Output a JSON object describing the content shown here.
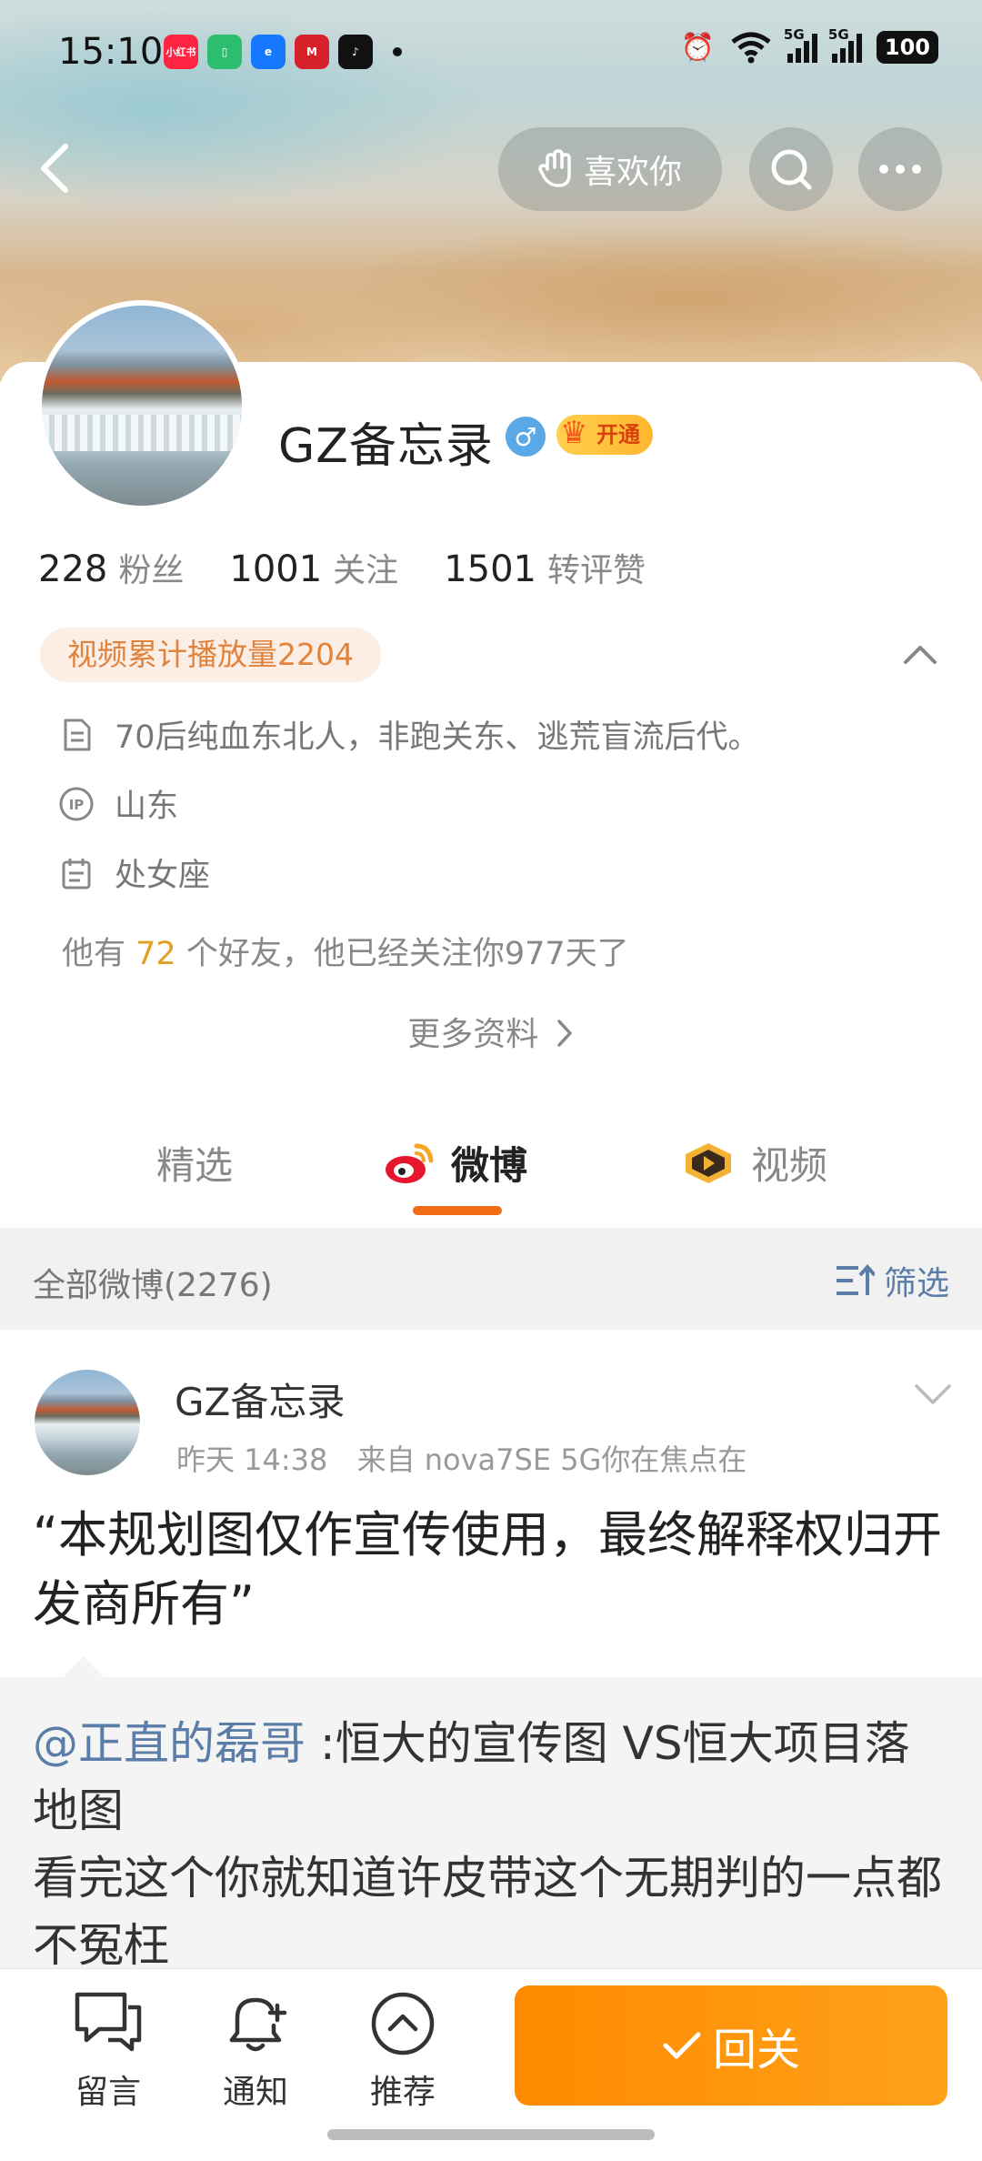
{
  "status_bar": {
    "time": "15:10",
    "app_icons": [
      "小红书",
      "battery-app-icon",
      "edge-icon",
      "cmb-icon",
      "tiktok-icon"
    ],
    "network_1": "5G",
    "network_2": "5G",
    "battery": "100"
  },
  "header": {
    "like_label": "喜欢你"
  },
  "profile": {
    "name": "GZ备忘录",
    "gender_symbol": "♂",
    "vip_label": "开通",
    "stats": [
      {
        "num": "228",
        "label": "粉丝"
      },
      {
        "num": "1001",
        "label": "关注"
      },
      {
        "num": "1501",
        "label": "转评赞"
      }
    ],
    "video_tag": "视频累计播放量2204",
    "bio": "70后纯血东北人，非跑关东、逃荒盲流后代。",
    "ip": "山东",
    "zodiac": "处女座",
    "friends_prefix": "他有",
    "friends_count": "72",
    "friends_suffix": "个好友，他已经关注你977天了",
    "more_info": "更多资料"
  },
  "tabs": [
    {
      "label": "精选"
    },
    {
      "label": "微博"
    },
    {
      "label": "视频"
    }
  ],
  "filter_bar": {
    "all_label": "全部微博(2276)",
    "filter_label": "筛选"
  },
  "post": {
    "author": "GZ备忘录",
    "time": "昨天 14:38",
    "source": "来自 nova7SE 5G你在焦点在",
    "text": "“本规划图仅作宣传使用，最终解释权归开发商所有”",
    "repost_mention": "@正直的磊哥",
    "repost_text_1": " :恒大的宣传图 VS恒大项目落地图",
    "repost_text_2": "看完这个你就知道许皮带这个无期判的一点都不冤枉"
  },
  "bottom_bar": {
    "comment_label": "留言",
    "notify_label": "通知",
    "recommend_label": "推荐",
    "follow_label": "回关"
  },
  "colors": {
    "accent_orange": "#ff8a00",
    "link_blue": "#5a7ea8",
    "tab_underline": "#f26b16",
    "video_tag_text": "#e0833d"
  }
}
